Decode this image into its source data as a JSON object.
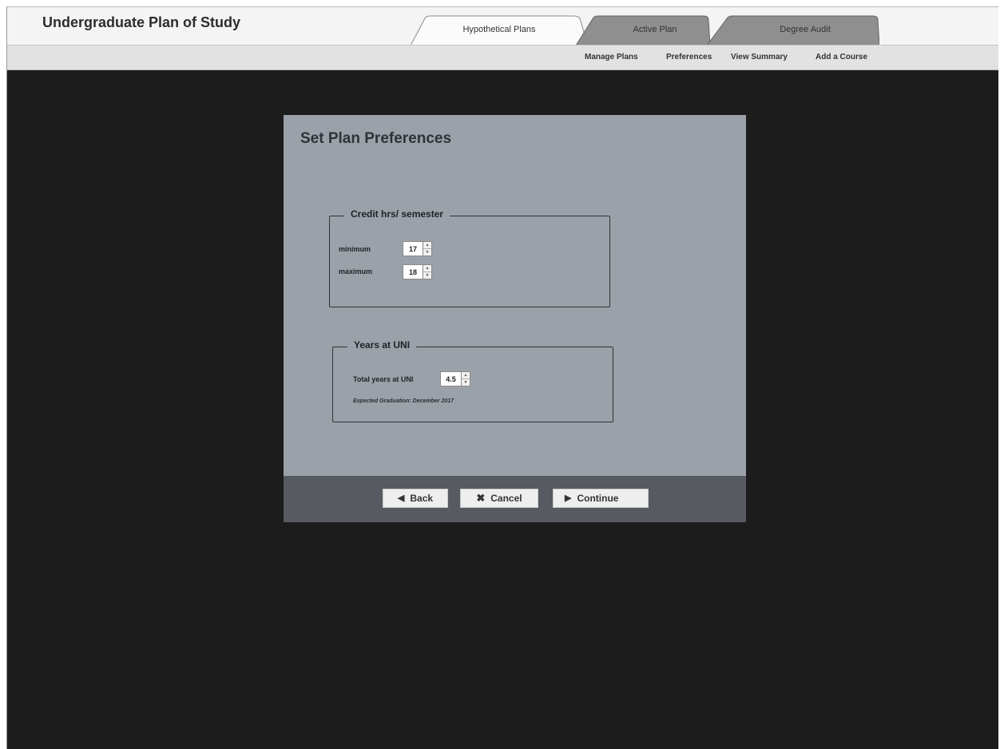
{
  "app": {
    "title": "Undergraduate Plan of Study"
  },
  "tabs": [
    {
      "label": "Hypothetical Plans",
      "active": true
    },
    {
      "label": "Active Plan",
      "active": false
    },
    {
      "label": "Degree Audit",
      "active": false
    }
  ],
  "subnav": [
    "Manage Plans",
    "Preferences",
    "View Summary",
    "Add a Course"
  ],
  "dialog": {
    "title": "Set Plan Preferences",
    "credit": {
      "legend": "Credit hrs/ semester",
      "minimum_label": "minimum",
      "minimum_value": "17",
      "maximum_label": "maximum",
      "maximum_value": "18"
    },
    "years": {
      "legend": "Years at UNI",
      "total_label": "Total years at UNI",
      "total_value": "4.5",
      "expected": "Expected Graduation: December 2017"
    },
    "buttons": {
      "back": "Back",
      "cancel": "Cancel",
      "continue": "Continue"
    }
  },
  "icons": {
    "back": "triangle-left-icon",
    "cancel": "x-icon",
    "continue": "triangle-right-icon",
    "spinner": "up-down-arrows-icon"
  },
  "colors": {
    "overlay": "#1c1c1c",
    "dialog": "#9ba1a8",
    "footer": "#575b61",
    "topbar": "#f4f4f4"
  }
}
